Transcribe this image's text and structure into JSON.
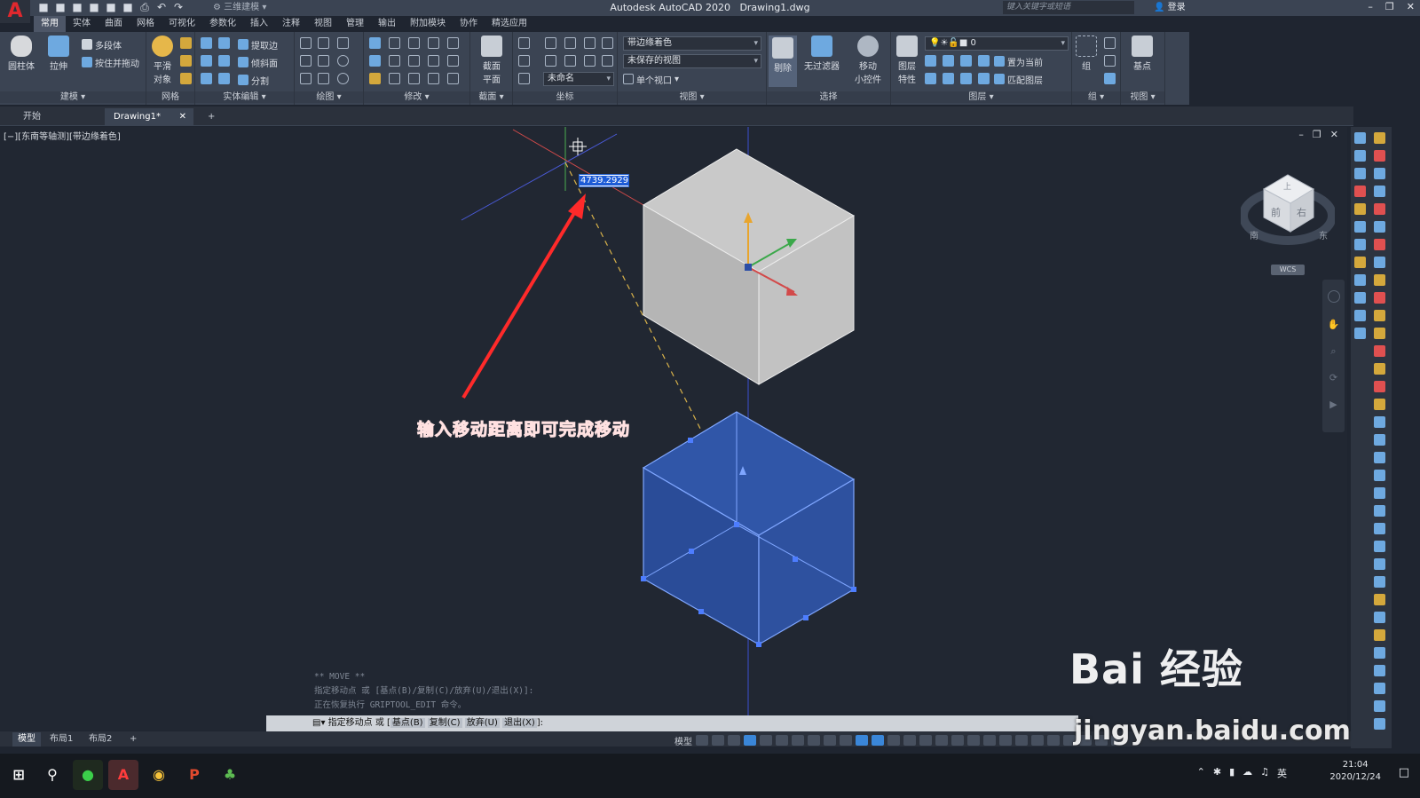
{
  "app": {
    "title": "Autodesk AutoCAD 2020",
    "file": "Drawing1.dwg",
    "workspace": "三维建模",
    "search_placeholder": "键入关键字或短语",
    "login_label": "登录"
  },
  "menu_tabs": [
    "常用",
    "实体",
    "曲面",
    "网格",
    "可视化",
    "参数化",
    "插入",
    "注释",
    "视图",
    "管理",
    "输出",
    "附加模块",
    "协作",
    "精选应用"
  ],
  "ribbon": {
    "panels": {
      "model": "建模",
      "mesh": "网格",
      "solid_edit": "实体编辑",
      "draw": "绘图",
      "modify": "修改",
      "section": "截面",
      "coords": "坐标",
      "view": "视图",
      "select": "选择",
      "layers": "图层",
      "groups": "组",
      "view2": "视图"
    },
    "buttons": {
      "cylinder": "圆柱体",
      "extrude": "拉伸",
      "polysolid": "多段体",
      "presspull": "按住并拖动",
      "smooth": "平滑",
      "smooth2": "对象",
      "extract_edges": "提取边",
      "taper": "倾斜面",
      "split": "分割",
      "section_plane": "截面",
      "section_plane2": "平面",
      "cull": "剔除",
      "no_filter": "无过滤器",
      "gizmo": "移动",
      "gizmo2": "小控件",
      "layer_props": "图层",
      "layer_props2": "特性",
      "set_current": "置为当前",
      "match_layer": "匹配图层",
      "group": "组",
      "base": "基点"
    },
    "combos": {
      "visual_style": "带边缘着色",
      "saved_view": "未保存的视图",
      "ucs_name": "未命名",
      "viewport": "单个视口",
      "layer": "0"
    }
  },
  "doc_tabs": {
    "start": "开始",
    "drawing": "Drawing1*"
  },
  "viewport": {
    "label": "[−][东南等轴测][带边缘着色]",
    "distance_input": "4739.2929",
    "annotation": "输入移动距离即可完成移动"
  },
  "viewcube": {
    "top": "上",
    "front": "前",
    "right": "右",
    "south": "南",
    "east": "东",
    "wcs": "WCS"
  },
  "command": {
    "history": [
      "** MOVE **",
      "指定移动点 或 [基点(B)/复制(C)/放弃(U)/退出(X)]:",
      "正在恢复执行 GRIPTOOL_EDIT 命令。"
    ],
    "prompt": "指定移动点 或 ",
    "options": [
      "基点(B)",
      "复制(C)",
      "放弃(U)",
      "退出(X)"
    ],
    "suffix": "]:"
  },
  "layout_tabs": [
    "模型",
    "布局1",
    "布局2"
  ],
  "status": {
    "model": "模型"
  },
  "taskbar": {
    "time": "21:04",
    "date": "2020/12/24",
    "ime": "英"
  },
  "watermark": {
    "brand": "Bai  经验",
    "url": "jingyan.baidu.com"
  },
  "colors": {
    "annotation": "#ff3033",
    "selection_blue": "#2d4f9e",
    "cube_gray": "#bdbdbd",
    "ribbon_bg": "#3b4453"
  }
}
